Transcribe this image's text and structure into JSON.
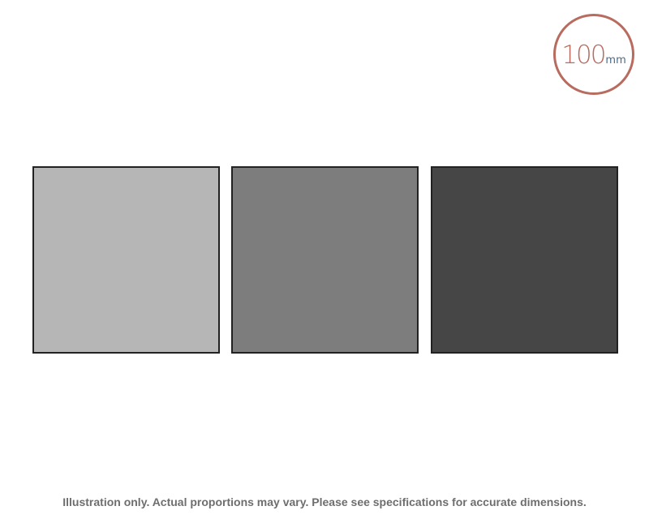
{
  "badge": {
    "number": "100",
    "unit": "mm",
    "ring_color": "#b86b5f",
    "number_color": "#b86b5f",
    "unit_color": "#4a6a86"
  },
  "swatches": [
    {
      "fill": "#b6b6b6"
    },
    {
      "fill": "#7d7d7d"
    },
    {
      "fill": "#464646"
    }
  ],
  "footer": {
    "note": "Illustration only. Actual proportions may vary. Please see specifications for accurate dimensions."
  }
}
